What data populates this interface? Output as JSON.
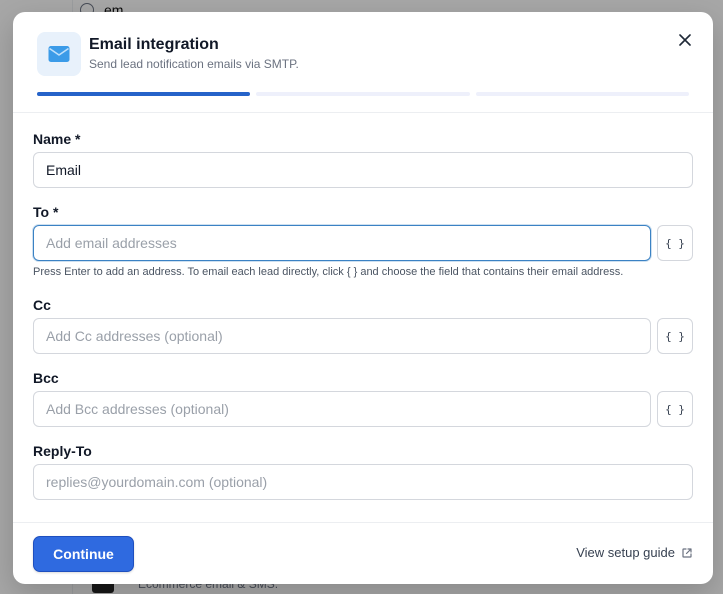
{
  "background": {
    "top_text": "em",
    "bottom_text": "Ecommerce email & SMS."
  },
  "modal": {
    "title": "Email integration",
    "subtitle": "Send lead notification emails via SMTP.",
    "icon": "envelope-icon",
    "steps": {
      "total": 3,
      "current": 1
    },
    "close_icon": "close-icon"
  },
  "form": {
    "name": {
      "label": "Name *",
      "value": "Email",
      "placeholder": ""
    },
    "to": {
      "label": "To *",
      "value": "",
      "placeholder": "Add email addresses",
      "var_button": "{ }",
      "hint": "Press Enter to add an address. To email each lead directly, click { } and choose the field that contains their email address."
    },
    "cc": {
      "label": "Cc",
      "value": "",
      "placeholder": "Add Cc addresses (optional)",
      "var_button": "{ }"
    },
    "bcc": {
      "label": "Bcc",
      "value": "",
      "placeholder": "Add Bcc addresses (optional)",
      "var_button": "{ }"
    },
    "reply_to": {
      "label": "Reply-To",
      "value": "",
      "placeholder": "replies@yourdomain.com (optional)"
    }
  },
  "footer": {
    "continue_label": "Continue",
    "guide_label": "View setup guide",
    "guide_icon": "external-link-icon"
  },
  "colors": {
    "accent": "#2f6ae0",
    "step_active": "#2563c9",
    "icon_bg": "#e8f1fb",
    "envelope": "#3b9be8"
  }
}
